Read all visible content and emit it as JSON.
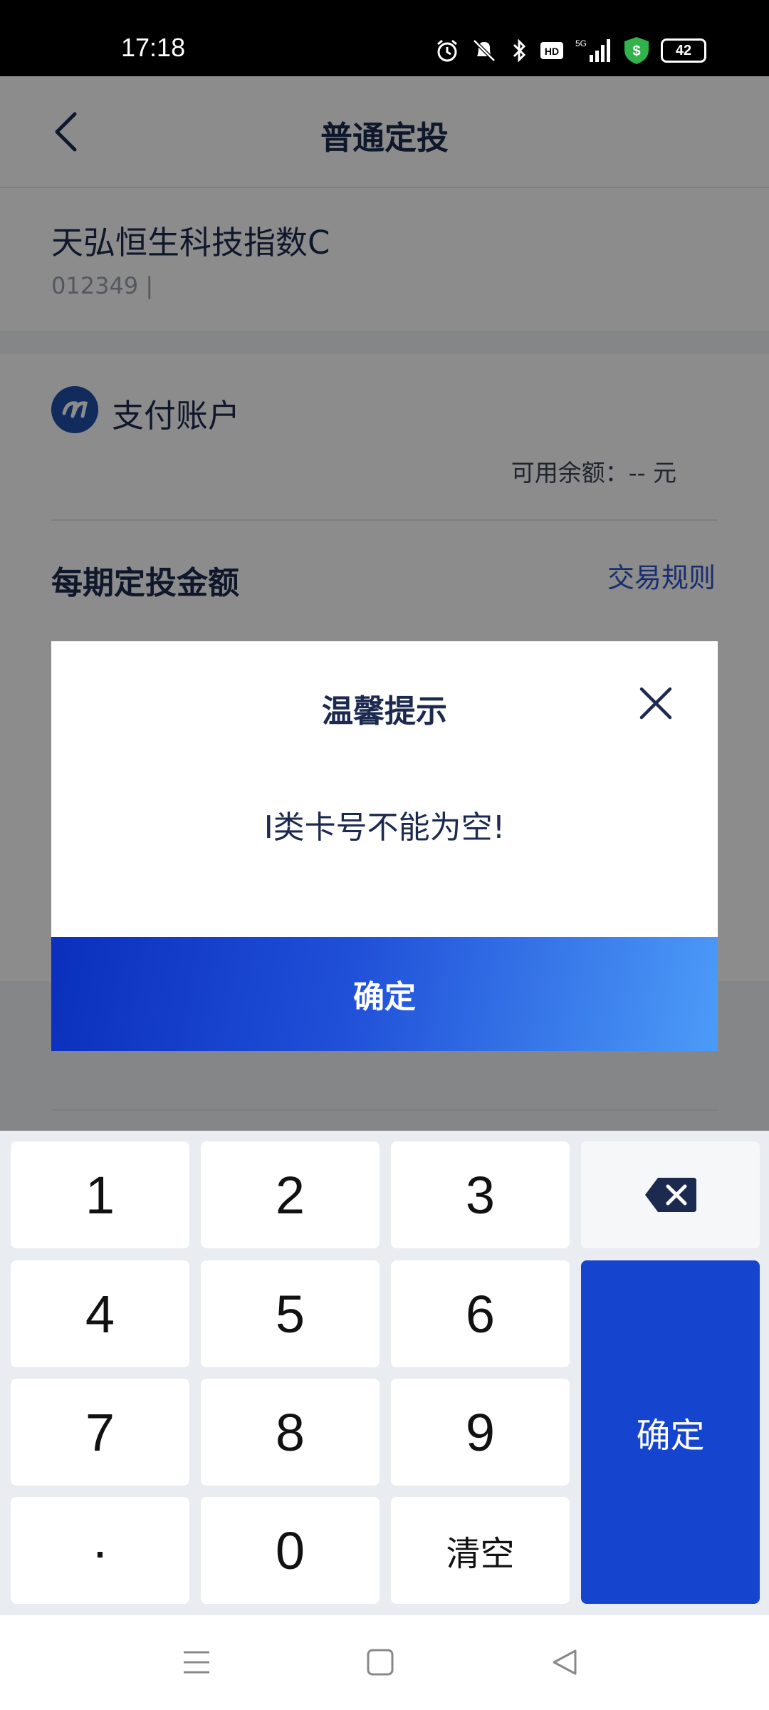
{
  "status_bar": {
    "time": "17:18",
    "battery": "42",
    "network": "5G",
    "icons": [
      "alarm-icon",
      "mute-icon",
      "bluetooth-icon",
      "hd-icon",
      "signal-icon",
      "shield-dollar-icon",
      "battery-icon"
    ]
  },
  "header": {
    "title": "普通定投"
  },
  "fund": {
    "name": "天弘恒生科技指数C",
    "code": "012349 |"
  },
  "payment": {
    "account_label": "支付账户",
    "balance_text": "可用余额：-- 元"
  },
  "amount": {
    "title": "每期定投金额",
    "rules_link": "交易规则"
  },
  "dialog": {
    "title": "温馨提示",
    "message": "I类卡号不能为空!",
    "confirm_label": "确定"
  },
  "keyboard": {
    "keys": [
      "1",
      "2",
      "3",
      "4",
      "5",
      "6",
      "7",
      "8",
      "9",
      "·",
      "0",
      "清空"
    ],
    "confirm_label": "确定"
  },
  "colors": {
    "primary": "#1544cf",
    "title_text": "#1d2a4f",
    "link": "#2c55c9"
  }
}
